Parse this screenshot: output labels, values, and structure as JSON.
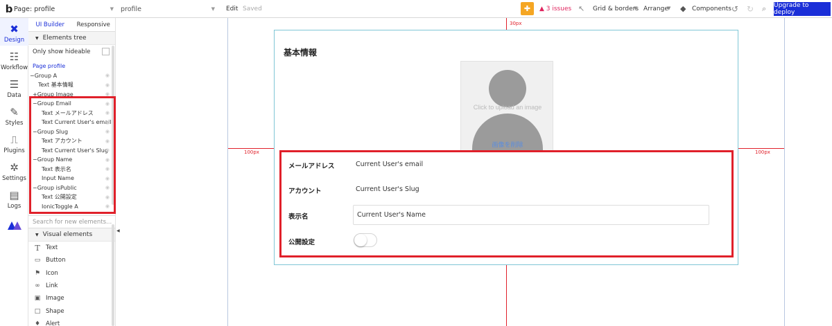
{
  "topbar": {
    "logo": "b",
    "page_select": "Page: profile",
    "page_name": "profile",
    "edit": "Edit",
    "saved": "Saved",
    "issues": "▲ 3 issues",
    "grid_borders": "Grid & borders",
    "arrange": "Arrange",
    "components": "Components",
    "deploy": "Upgrade to deploy"
  },
  "rail": {
    "items": [
      {
        "label": "Design",
        "icon": "✖"
      },
      {
        "label": "Workflow",
        "icon": "☷"
      },
      {
        "label": "Data",
        "icon": "☰"
      },
      {
        "label": "Styles",
        "icon": "✎"
      },
      {
        "label": "Plugins",
        "icon": "⎍"
      },
      {
        "label": "Settings",
        "icon": "✲"
      },
      {
        "label": "Logs",
        "icon": "▤"
      }
    ]
  },
  "panel": {
    "tabs": [
      "UI Builder",
      "Responsive"
    ],
    "elements_tree": "Elements tree",
    "only_show_hideable": "Only show hideable",
    "tree": [
      {
        "label": "Page profile",
        "indent": 0,
        "type": "page"
      },
      {
        "label": "−Group A",
        "indent": 0
      },
      {
        "label": "Text 基本情報",
        "indent": 1
      },
      {
        "label": "+Group Image",
        "indent": 0.5
      },
      {
        "label": "−Group Email",
        "indent": 0.5
      },
      {
        "label": "Text メールアドレス",
        "indent": 1.5
      },
      {
        "label": "Text Current User's email",
        "indent": 1.5
      },
      {
        "label": "−Group Slug",
        "indent": 0.5
      },
      {
        "label": "Text アカウント",
        "indent": 1.5
      },
      {
        "label": "Text Current User's Slug",
        "indent": 1.5
      },
      {
        "label": "−Group Name",
        "indent": 0.5
      },
      {
        "label": "Text 表示名",
        "indent": 1.5
      },
      {
        "label": "Input Name",
        "indent": 1.5
      },
      {
        "label": "−Group isPublic",
        "indent": 0.5
      },
      {
        "label": "Text 公開設定",
        "indent": 1.5
      },
      {
        "label": "IonicToggle A",
        "indent": 1.5
      }
    ],
    "search_placeholder": "Search for new elements...",
    "visual_elements": "Visual elements",
    "visual_items": [
      {
        "label": "Text",
        "icon": "T"
      },
      {
        "label": "Button",
        "icon": "▭"
      },
      {
        "label": "Icon",
        "icon": "⚑"
      },
      {
        "label": "Link",
        "icon": "∞"
      },
      {
        "label": "Image",
        "icon": "▣"
      },
      {
        "label": "Shape",
        "icon": "□"
      },
      {
        "label": "Alert",
        "icon": "♦"
      }
    ]
  },
  "canvas": {
    "top_margin": "30px",
    "left_margin": "100px",
    "right_margin": "100px",
    "card_title": "基本情報",
    "image_placeholder": "Click to upload an image",
    "image_delete": "画像を削除",
    "rows": [
      {
        "label": "メールアドレス",
        "value": "Current User's email"
      },
      {
        "label": "アカウント",
        "value": "Current User's Slug"
      },
      {
        "label": "表示名",
        "value": "Current User's Name"
      },
      {
        "label": "公開設定",
        "value": ""
      }
    ],
    "toggle_on": false
  },
  "colors": {
    "accent": "#1b2fd8",
    "highlight": "#e0202a",
    "issues": "#e0245e",
    "gift": "#f5a623"
  }
}
